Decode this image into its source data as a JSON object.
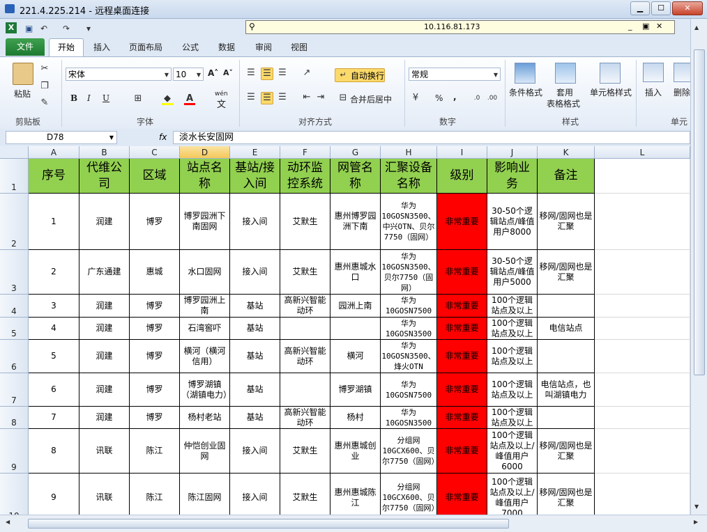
{
  "window": {
    "title": "221.4.225.214 - 远程桌面连接",
    "btn_min": "▁",
    "btn_max": "☐",
    "btn_close": "✕"
  },
  "rd_bar": {
    "ip": "10.116.81.173",
    "pin": "⚲",
    "min": "_",
    "restore": "▣",
    "close": "✕"
  },
  "qat": {
    "save": "▣",
    "undo": "↶",
    "redo": "↷",
    "customize": "▾"
  },
  "tabs": {
    "file": "文件",
    "home": "开始",
    "insert": "插入",
    "layout": "页面布局",
    "formulas": "公式",
    "data": "数据",
    "review": "审阅",
    "view": "视图"
  },
  "ribbon": {
    "clipboard": {
      "paste": "粘贴",
      "label": "剪贴板"
    },
    "font": {
      "name": "宋体",
      "size": "10",
      "grow": "A˄",
      "shrink": "A˅",
      "bold": "B",
      "italic": "I",
      "underline": "U",
      "label": "字体",
      "phonetic": "wén",
      "phonetic_char": "文"
    },
    "alignment": {
      "wrap": "自动换行",
      "merge": "合并后居中",
      "label": "对齐方式"
    },
    "number": {
      "format": "常规",
      "label": "数字",
      "percent": "%",
      "comma": ","
    },
    "styles": {
      "conditional": "条件格式",
      "table_line1": "套用",
      "table_line2": "表格格式",
      "cell_styles": "单元格样式",
      "label": "样式"
    },
    "cells": {
      "insert": "插入",
      "delete": "删除",
      "label": "单元格"
    }
  },
  "formula_bar": {
    "name_box": "D78",
    "fx": "fx",
    "value": "淡水长安固网"
  },
  "columns": [
    "A",
    "B",
    "C",
    "D",
    "E",
    "F",
    "G",
    "H",
    "I",
    "J",
    "K",
    "L"
  ],
  "header_row": {
    "num": "1",
    "cells": [
      "序号",
      "代维公司",
      "区域",
      "站点名称",
      "基站/接入间",
      "动环监控系统",
      "网管名称",
      "汇聚设备名称",
      "级别",
      "影响业务",
      "备注"
    ]
  },
  "rows": [
    {
      "num": "2",
      "cells": [
        "1",
        "润建",
        "博罗",
        "博罗园洲下南固网",
        "接入间",
        "艾默生",
        "惠州博罗园洲下南",
        "华为10GOSN3500、中兴OTN、贝尔7750（固网）",
        "非常重要",
        "30-50个逻辑站点/峰值用户8000",
        "移网/固网也是汇聚"
      ]
    },
    {
      "num": "3",
      "cells": [
        "2",
        "广东通建",
        "惠城",
        "水口固网",
        "接入间",
        "艾默生",
        "惠州惠城水口",
        "华为10GOSN3500、贝尔7750（固网）",
        "非常重要",
        "30-50个逻辑站点/峰值用户5000",
        "移网/固网也是汇聚"
      ]
    },
    {
      "num": "4",
      "cells": [
        "3",
        "润建",
        "博罗",
        "博罗园洲上南",
        "基站",
        "高新兴智能动环",
        "园洲上南",
        "华为10GOSN7500",
        "非常重要",
        "100个逻辑站点及以上",
        ""
      ]
    },
    {
      "num": "5",
      "cells": [
        "4",
        "润建",
        "博罗",
        "石湾窖吓",
        "基站",
        "",
        "",
        "华为10GOSN3500",
        "非常重要",
        "100个逻辑站点及以上",
        "电信站点"
      ]
    },
    {
      "num": "6",
      "cells": [
        "5",
        "润建",
        "博罗",
        "横河（横河信用）",
        "基站",
        "高新兴智能动环",
        "横河",
        "华为10GOSN3500、烽火OTN",
        "非常重要",
        "100个逻辑站点及以上",
        ""
      ]
    },
    {
      "num": "7",
      "cells": [
        "6",
        "润建",
        "博罗",
        "博罗湖镇（湖镇电力）",
        "基站",
        "",
        "博罗湖镇",
        "华为10GOSN7500",
        "非常重要",
        "100个逻辑站点及以上",
        "电信站点，也叫湖镇电力"
      ]
    },
    {
      "num": "8",
      "cells": [
        "7",
        "润建",
        "博罗",
        "杨村老站",
        "基站",
        "高新兴智能动环",
        "杨村",
        "华为10GOSN3500",
        "非常重要",
        "100个逻辑站点及以上",
        ""
      ]
    },
    {
      "num": "9",
      "cells": [
        "8",
        "讯联",
        "陈江",
        "仲恺创业固网",
        "接入间",
        "艾默生",
        "惠州惠城创业",
        "分组网10GCX600、贝尔7750（固网）",
        "非常重要",
        "100个逻辑站点及以上/峰值用户6000",
        "移网/固网也是汇聚"
      ]
    },
    {
      "num": "10",
      "cells": [
        "9",
        "讯联",
        "陈江",
        "陈江固网",
        "接入间",
        "艾默生",
        "惠州惠城陈江",
        "分组网10GCX600、贝尔7750（固网）",
        "非常重要",
        "100个逻辑站点及以上/峰值用户7000",
        "移网/固网也是汇聚"
      ]
    }
  ],
  "colors": {
    "header_fill": "#92d050",
    "critical_fill": "#ff0000",
    "file_tab": "#2e8b3e"
  },
  "icons": [
    "excel-icon",
    "save-icon",
    "undo-icon",
    "redo-icon",
    "paste-icon",
    "cut-icon",
    "copy-icon",
    "format-painter-icon",
    "bold-icon",
    "italic-icon",
    "underline-icon",
    "borders-icon",
    "fill-color-icon",
    "font-color-icon",
    "align-left-icon",
    "align-center-icon",
    "align-right-icon",
    "wrap-text-icon",
    "merge-icon",
    "currency-icon",
    "conditional-format-icon",
    "table-format-icon",
    "cell-styles-icon",
    "insert-cells-icon",
    "delete-cells-icon",
    "fx-icon"
  ]
}
